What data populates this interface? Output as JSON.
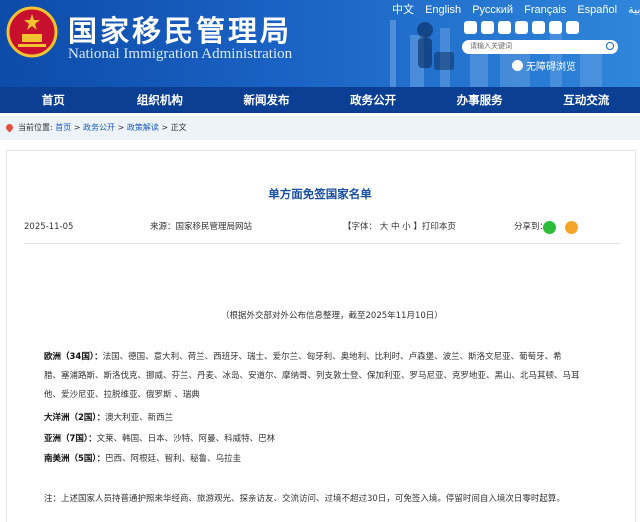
{
  "header": {
    "title": "国家移民管理局",
    "subtitle": "National Immigration Administration",
    "languages": [
      "中文",
      "English",
      "Русский",
      "Français",
      "Español",
      "عربية"
    ],
    "search_placeholder": "请输入关键词",
    "barrier_label": "无障碍浏览",
    "brand_color": "#0d4ba8"
  },
  "nav": {
    "items": [
      "首页",
      "组织机构",
      "新闻发布",
      "政务公开",
      "办事服务",
      "互动交流"
    ]
  },
  "breadcrumb": {
    "prefix": "当前位置:",
    "items": [
      "首页",
      "政务公开",
      "政策解读",
      "正文"
    ],
    "separator": ">"
  },
  "article": {
    "title": "单方面免签国家名单",
    "date": "2025-11-05",
    "source": "来源：国家移民管理局网站",
    "font_label": "【字体：",
    "font_sizes": [
      "大",
      "中",
      "小"
    ],
    "print_label": "】打印本页",
    "share_label": "分享到：",
    "note": "（根据外交部对外公布信息整理，截至2025年11月10日）",
    "europe_label": "欧洲（34国）：",
    "europe_line1": "法国、德国、意大利、荷兰、西班牙、瑞士、爱尔兰、匈牙利、奥地利、比利时、卢森堡、波兰、斯洛文尼亚、葡萄牙、希",
    "europe_line2": "腊、塞浦路斯、斯洛伐克、挪威、芬兰、丹麦、冰岛、安道尔、摩纳哥、列支敦士登、保加利亚、罗马尼亚、克罗地亚、黑山、北马其顿、马耳",
    "europe_line3": "他、爱沙尼亚、拉脱维亚、俄罗斯 、瑞典",
    "oceania_label": "大洋洲（2国）：",
    "oceania": "澳大利亚、新西兰",
    "asia_label": "亚洲（7国）：",
    "asia": "文莱、韩国、日本、沙特、阿曼、科威特、巴林",
    "samerica_label": "南美洲（5国）：",
    "samerica": "巴西、阿根廷、智利、秘鲁、乌拉圭",
    "footnote": "注：上述国家人员持普通护照来华经商、旅游观光、探亲访友、交流访问、过境不超过30日，可免签入境。停留时间自入境次日零时起算。"
  }
}
